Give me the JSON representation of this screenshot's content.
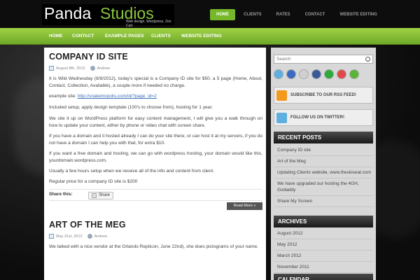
{
  "header": {
    "logo_panda": "Panda",
    "logo_studios": "Studios",
    "tagline": "Web design, Wordpress, Zen Cart",
    "top_nav": [
      "HOME",
      "CLIENTS",
      "RATES",
      "CONTACT",
      "WEBSITE EDITING"
    ]
  },
  "main_nav": [
    "HOME",
    "CONTACT",
    "EXAMPLE PAGES",
    "CLIENTS",
    "WEBSITE EDITING"
  ],
  "post1": {
    "title": "COMPANY ID SITE",
    "date": "August 8th, 2012",
    "author": "Andrew",
    "p1": "It is Wild Wednesday (8/8/2012), today's special is a Company ID site for $50,  a 5 page (Home, About, Contact, Collection, Available), a couple more if needed no charge.",
    "p2_label": "example site: ",
    "p2_link": "http://snaketropolis.com/id/?page_id=2",
    "p3": "Included setup, apply design template (100's to choose from), hosting for 1 year.",
    "p4": "We site it up on WordPress platform for easy content management, I will give you a walk through on how to update your content, either by phone or video chat with screen share.",
    "p5": "If you have a domain and it hosted already I can do your site there, or can host it at my servers, if you do not have a domain I can help you with that, for extra $10.",
    "p6": "If you want a free domain and hosting, we can go with wordpress hosting, your domain would like this,  yourdomain.wordpress.com.",
    "p7": "Usually a few hours setup when we receive all of the info and content from client.",
    "p8": "Regular price for a company ID site is $200",
    "share_label": "Share this:",
    "share_button": "Share",
    "read_more": "Read More »"
  },
  "post2": {
    "title": "ART OF THE MEG",
    "date": "May 31st, 2012",
    "author": "Andrew",
    "p1": "We talked with a nice vendor  at the Orlando Repticon, June 22nd), she does pictograms of your name."
  },
  "sidebar": {
    "search_placeholder": "Search",
    "social_icons": [
      {
        "icon": "twitter-icon",
        "color": "#5fb0e0"
      },
      {
        "icon": "delicious-icon",
        "color": "#3a6bc4"
      },
      {
        "icon": "digg-icon",
        "color": "#d0d0d0"
      },
      {
        "icon": "facebook-icon",
        "color": "#3b5998"
      },
      {
        "icon": "stumbleupon-icon",
        "color": "#2eaa3a"
      },
      {
        "icon": "favorite-icon",
        "color": "#e04848"
      },
      {
        "icon": "add-icon",
        "color": "#5ab43a"
      }
    ],
    "rss_label": "SUBSCRIBE TO OUR RSS FEED!",
    "twitter_label": "FOLLOW US ON TWITTER!",
    "recent_posts_title": "RECENT POSTS",
    "recent_posts": [
      "Company ID site",
      "Art of the Meg",
      "Updating Clients website, www.theskiseat.com",
      "We have upgraded our hosting the 4GH, Godaddy",
      "Share My Screen"
    ],
    "archives_title": "ARCHIVES",
    "archives": [
      "August 2012",
      "May 2012",
      "March 2012",
      "November 2011"
    ],
    "calendar_title": "CALENDAR"
  },
  "colors": {
    "accent": "#8dc63f",
    "nav_green": "#76b82a"
  }
}
